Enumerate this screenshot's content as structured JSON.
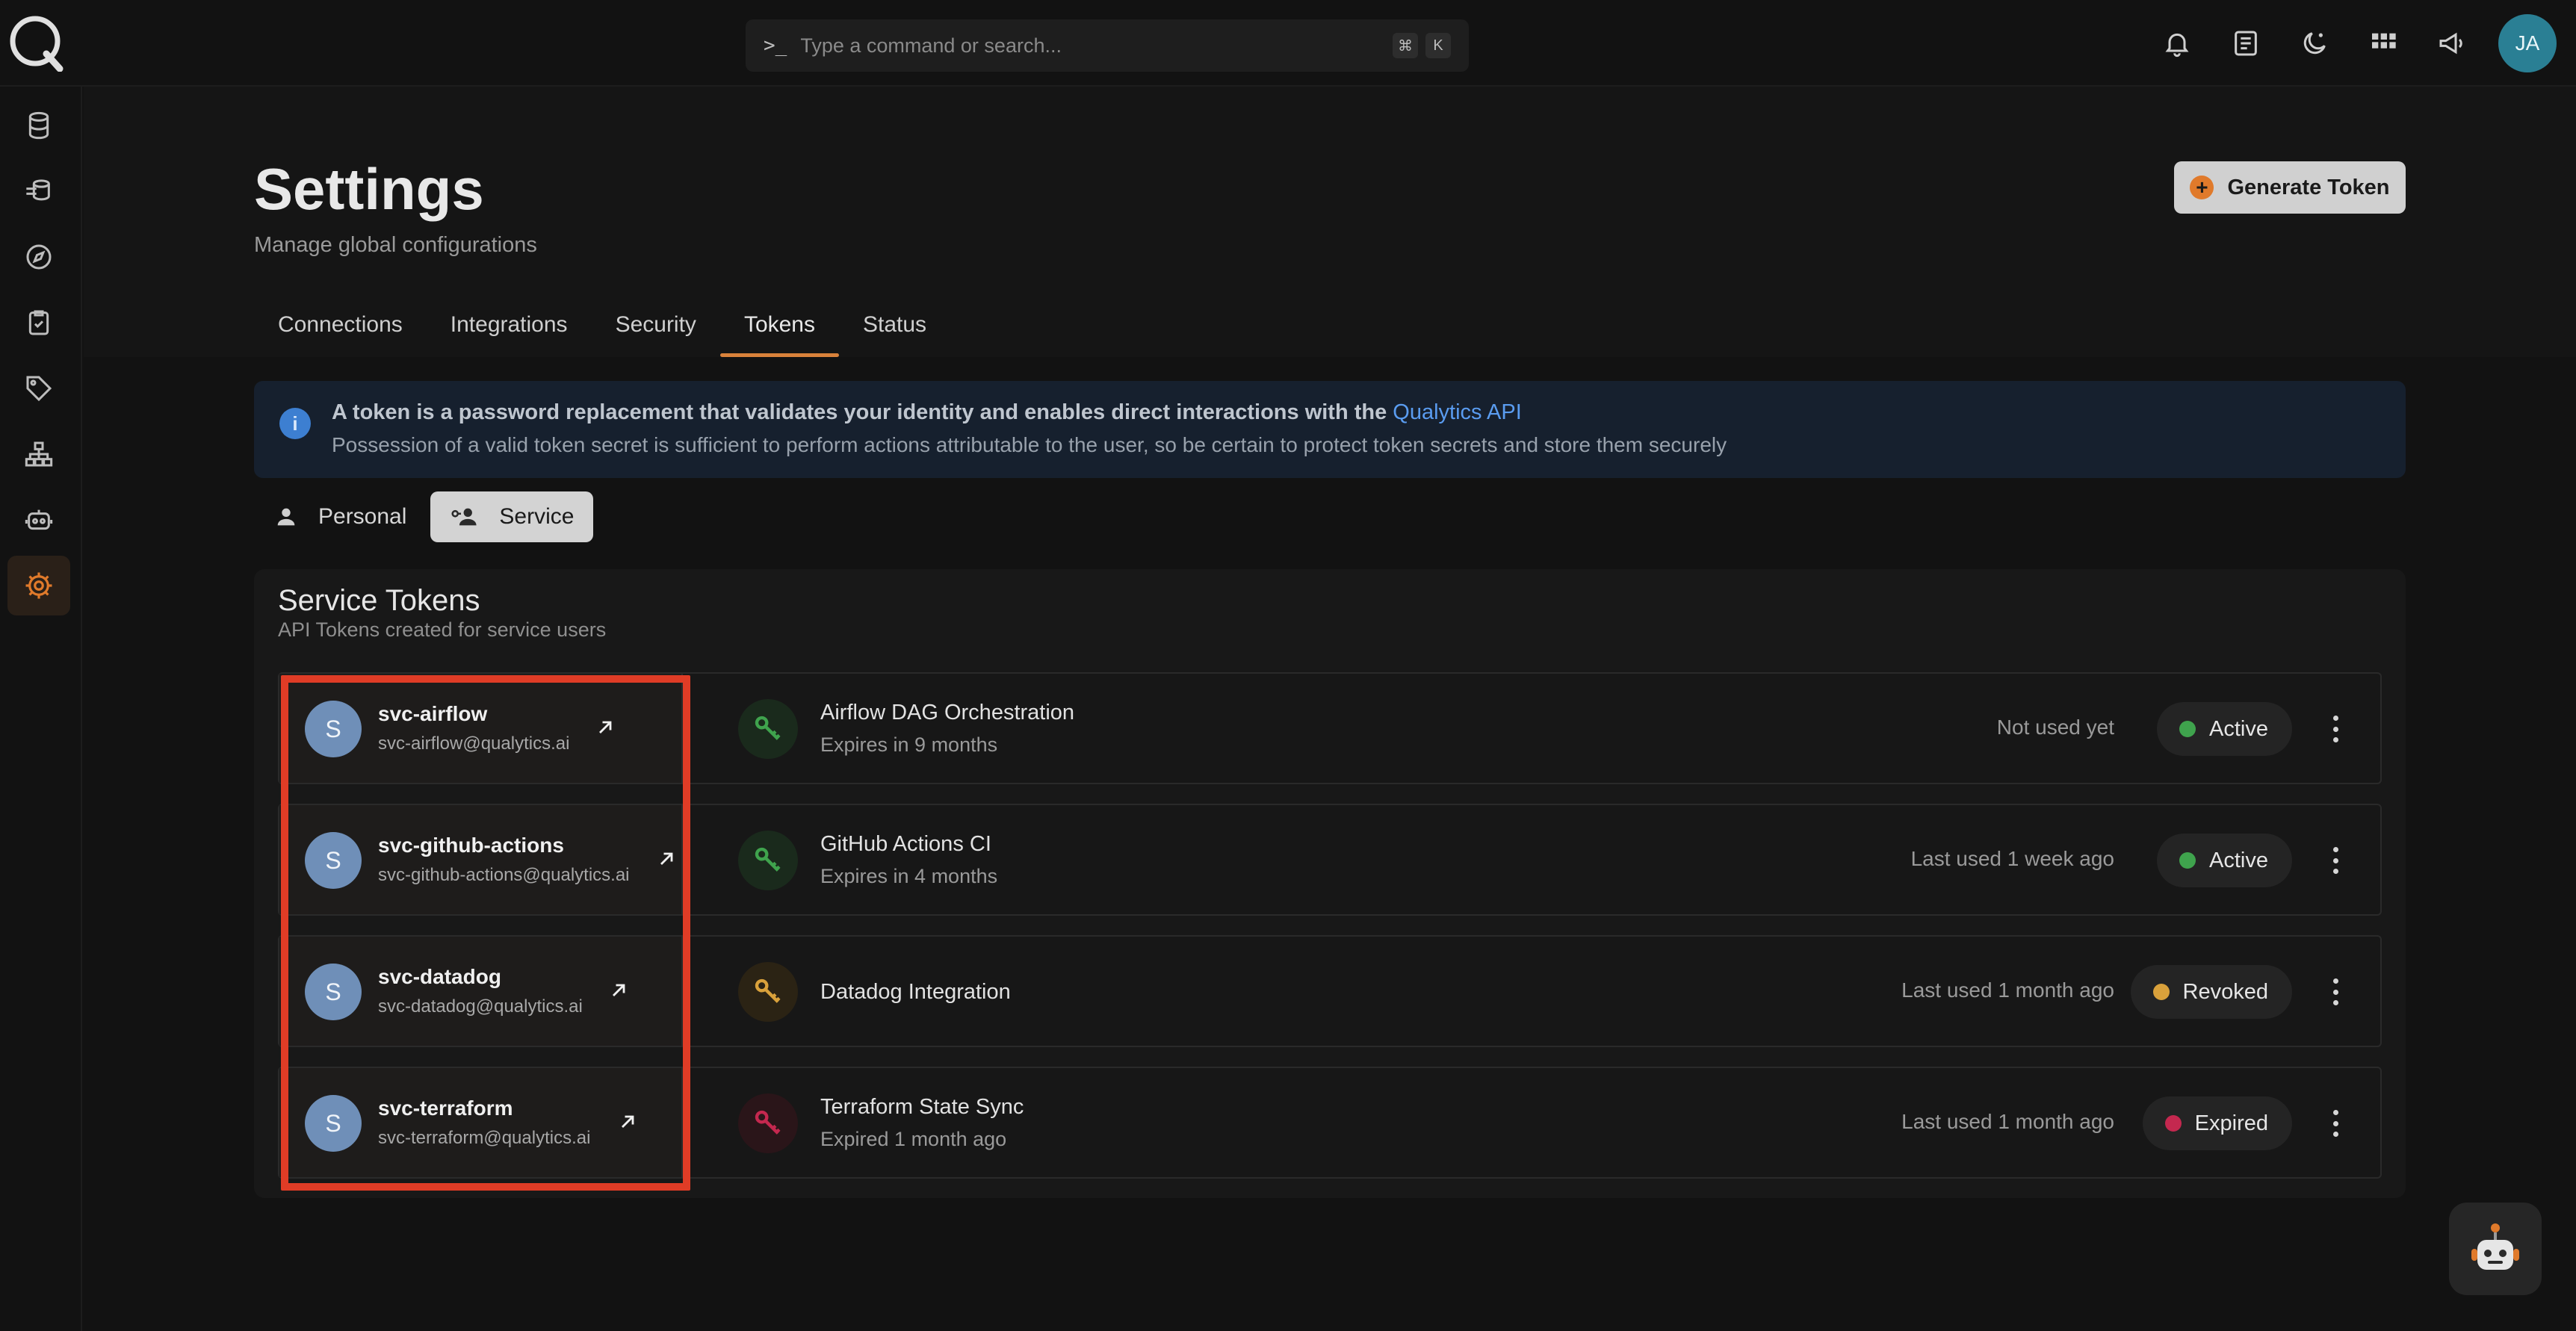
{
  "topbar": {
    "search_placeholder": "Type a command or search...",
    "shortcut_keys": [
      "⌘",
      "K"
    ],
    "icons": [
      "bell-icon",
      "notes-icon",
      "theme-moon-icon",
      "apps-grid-icon",
      "megaphone-icon"
    ],
    "user_initials": "JA"
  },
  "sidebar": {
    "items": [
      {
        "icon": "database-icon"
      },
      {
        "icon": "datastore-stack-icon"
      },
      {
        "icon": "compass-icon"
      },
      {
        "icon": "clipboard-check-icon"
      },
      {
        "icon": "tag-icon"
      },
      {
        "icon": "hierarchy-icon"
      },
      {
        "icon": "robot-icon"
      },
      {
        "icon": "gear-icon",
        "active": true
      }
    ]
  },
  "page": {
    "title": "Settings",
    "subtitle": "Manage global configurations",
    "generate_button": "Generate Token"
  },
  "tabs": [
    "Connections",
    "Integrations",
    "Security",
    "Tokens",
    "Status"
  ],
  "active_tab": "Tokens",
  "info": {
    "line1": "A token is a password replacement that validates your identity and enables direct interactions with the ",
    "link": "Qualytics API",
    "line2": "Possession of a valid token secret is sufficient to perform actions attributable to the user, so be certain to protect token secrets and store them securely"
  },
  "toggle": {
    "personal": "Personal",
    "service": "Service",
    "active": "Service"
  },
  "card": {
    "title": "Service Tokens",
    "subtitle": "API Tokens created for service users"
  },
  "tokens": [
    {
      "initial": "S",
      "user": "svc-airflow",
      "email": "svc-airflow@qualytics.ai",
      "name": "Airflow DAG Orchestration",
      "expiry": "Expires in 9 months",
      "usage": "Not used yet",
      "status": "Active"
    },
    {
      "initial": "S",
      "user": "svc-github-actions",
      "email": "svc-github-actions@qualytics.ai",
      "name": "GitHub Actions CI",
      "expiry": "Expires in 4 months",
      "usage": "Last used 1 week ago",
      "status": "Active"
    },
    {
      "initial": "S",
      "user": "svc-datadog",
      "email": "svc-datadog@qualytics.ai",
      "name": "Datadog Integration",
      "expiry": "",
      "usage": "Last used 1 month ago",
      "status": "Revoked"
    },
    {
      "initial": "S",
      "user": "svc-terraform",
      "email": "svc-terraform@qualytics.ai",
      "name": "Terraform State Sync",
      "expiry": "Expired 1 month ago",
      "usage": "Last used 1 month ago",
      "status": "Expired"
    }
  ],
  "colors": {
    "accent": "#d9823b",
    "active": "#3fa34d",
    "revoked": "#d9a13b",
    "expired": "#c4284f",
    "highlight": "#e03c26"
  }
}
